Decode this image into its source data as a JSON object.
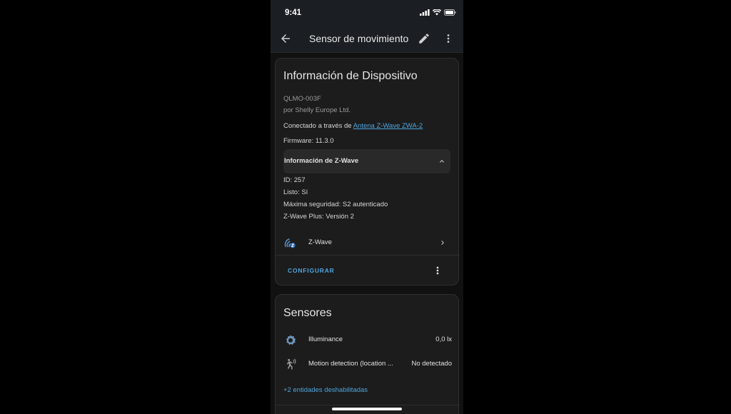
{
  "status": {
    "time": "9:41"
  },
  "appbar": {
    "title": "Sensor de movimiento"
  },
  "device_card": {
    "title": "Información de Dispositivo",
    "model": "QLMO-003F",
    "manufacturer": "por Shelly Europe Ltd.",
    "connected_prefix": "Conectado a través de ",
    "connected_link": "Antena Z-Wave ZWA-2",
    "firmware": "Firmware: 11.3.0",
    "zwave_section": {
      "header": "Información de Z-Wave",
      "lines": [
        "ID: 257",
        "Listo: Sí",
        "Máxima seguridad: S2 autenticado",
        "Z-Wave Plus: Versión 2"
      ]
    },
    "integration": {
      "label": "Z-Wave",
      "icon": "zwave-icon"
    },
    "configure_label": "CONFIGURAR"
  },
  "sensors_card": {
    "title": "Sensores",
    "entities": [
      {
        "label": "Illuminance",
        "value": "0,0 lx",
        "icon": "brightness-icon"
      },
      {
        "label": "Motion detection (location ...",
        "value": "No detectado",
        "icon": "motion-sensor-icon"
      }
    ],
    "disabled_link": "+2 entidades deshabilitadas"
  },
  "colors": {
    "accent": "#4ea5dd",
    "card": "#1c1c1c",
    "background": "#111111",
    "appbar": "#1b1f23"
  }
}
